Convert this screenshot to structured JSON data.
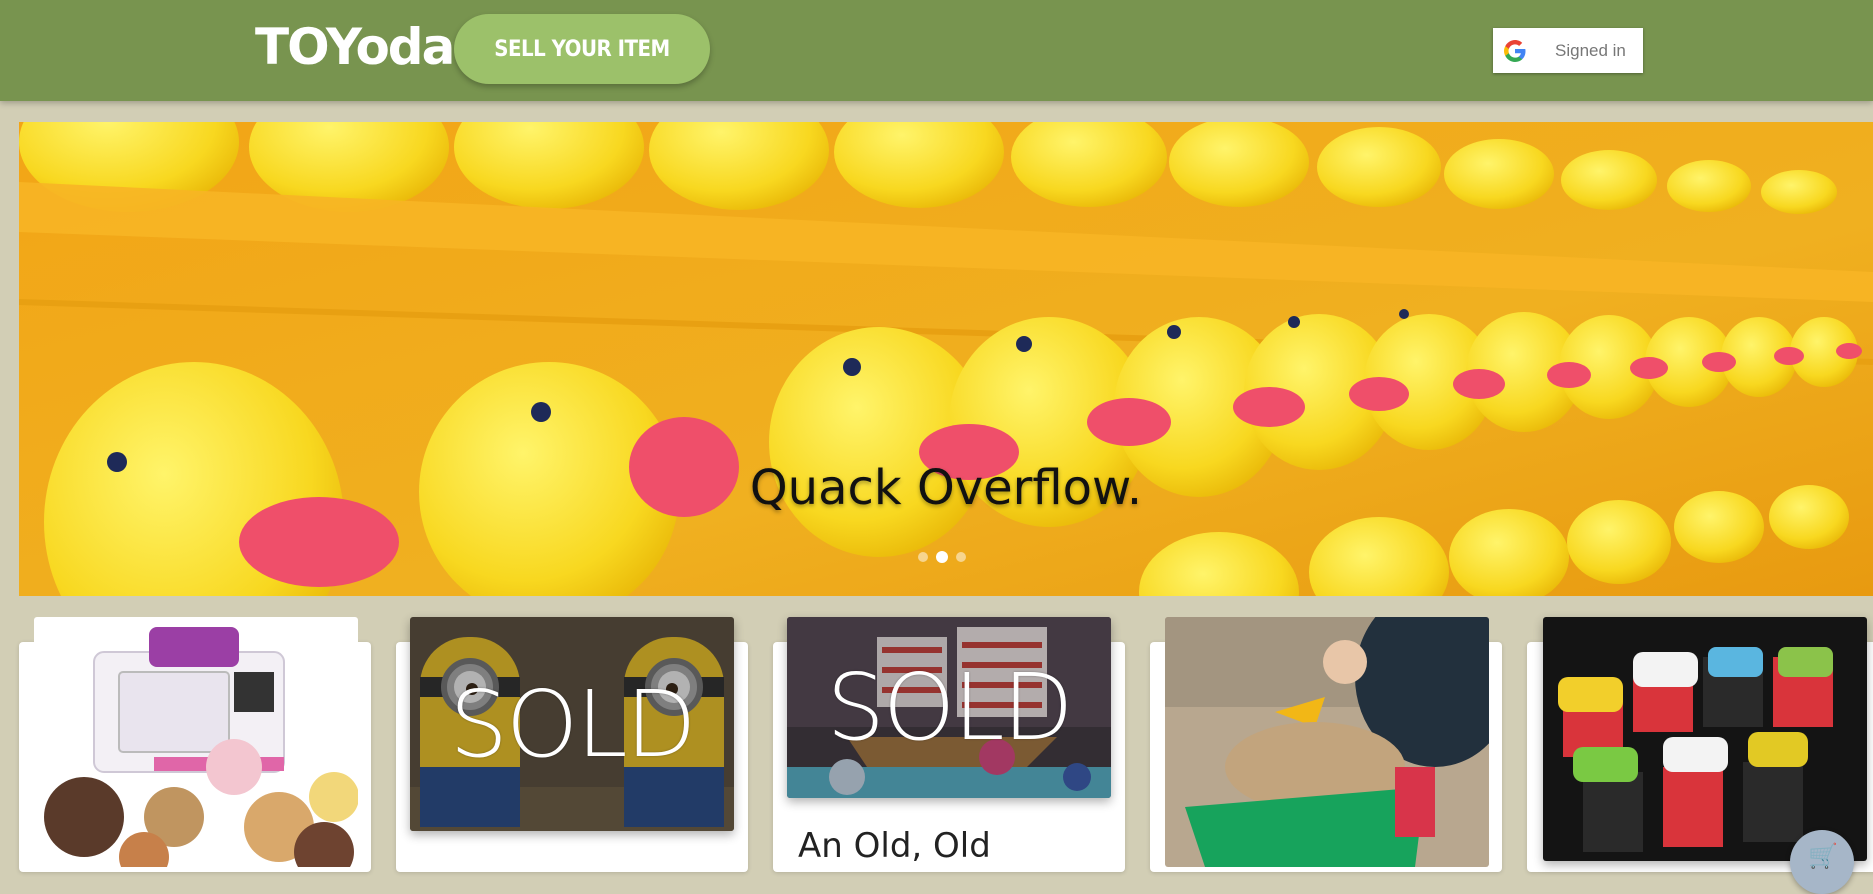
{
  "header": {
    "logo": "TOYoda",
    "sell_button": "SELL YOUR ITEM",
    "signin": {
      "icon": "google-icon",
      "label": "Signed in"
    },
    "background": "#78944f",
    "sell_button_color": "#9cc16a"
  },
  "hero": {
    "caption": "Quack Overflow.",
    "slides": 3,
    "active_slide": 2
  },
  "cards": [
    {
      "image": "easy-bake-oven",
      "sold": ""
    },
    {
      "image": "minions-figures",
      "sold": "SOLD"
    },
    {
      "image": "toy-ship",
      "sold": "SOLD",
      "title": "An Old, Old"
    },
    {
      "image": "sand-truck",
      "sold": ""
    },
    {
      "image": "toy-cars",
      "sold": ""
    }
  ],
  "cart_fab": {
    "icon": "cart-icon"
  }
}
